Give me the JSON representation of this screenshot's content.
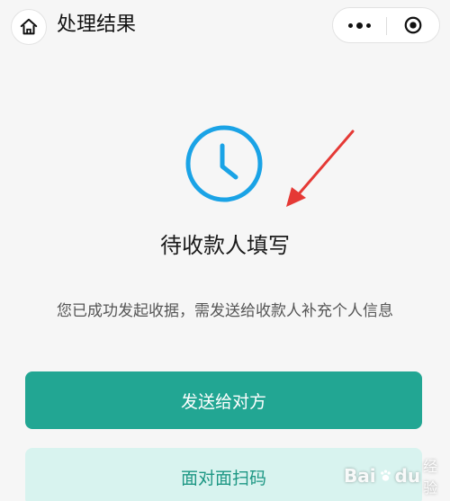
{
  "navbar": {
    "title": "处理结果",
    "home_icon": "home-icon",
    "more_icon": "more-dots-icon",
    "close_icon": "target-close-icon"
  },
  "status": {
    "icon": "clock-icon",
    "title": "待收款人填写",
    "description": "您已成功发起收据，需发送给收款人补充个人信息"
  },
  "actions": {
    "send_label": "发送给对方",
    "scan_label": "面对面扫码"
  },
  "watermark": {
    "brand_left": "Bai",
    "brand_right": "du",
    "sub": "经验"
  },
  "colors": {
    "accent": "#22a693",
    "accent_light": "#d8f3ef",
    "clock": "#1aa3e6",
    "annotation_arrow": "#e53935"
  }
}
